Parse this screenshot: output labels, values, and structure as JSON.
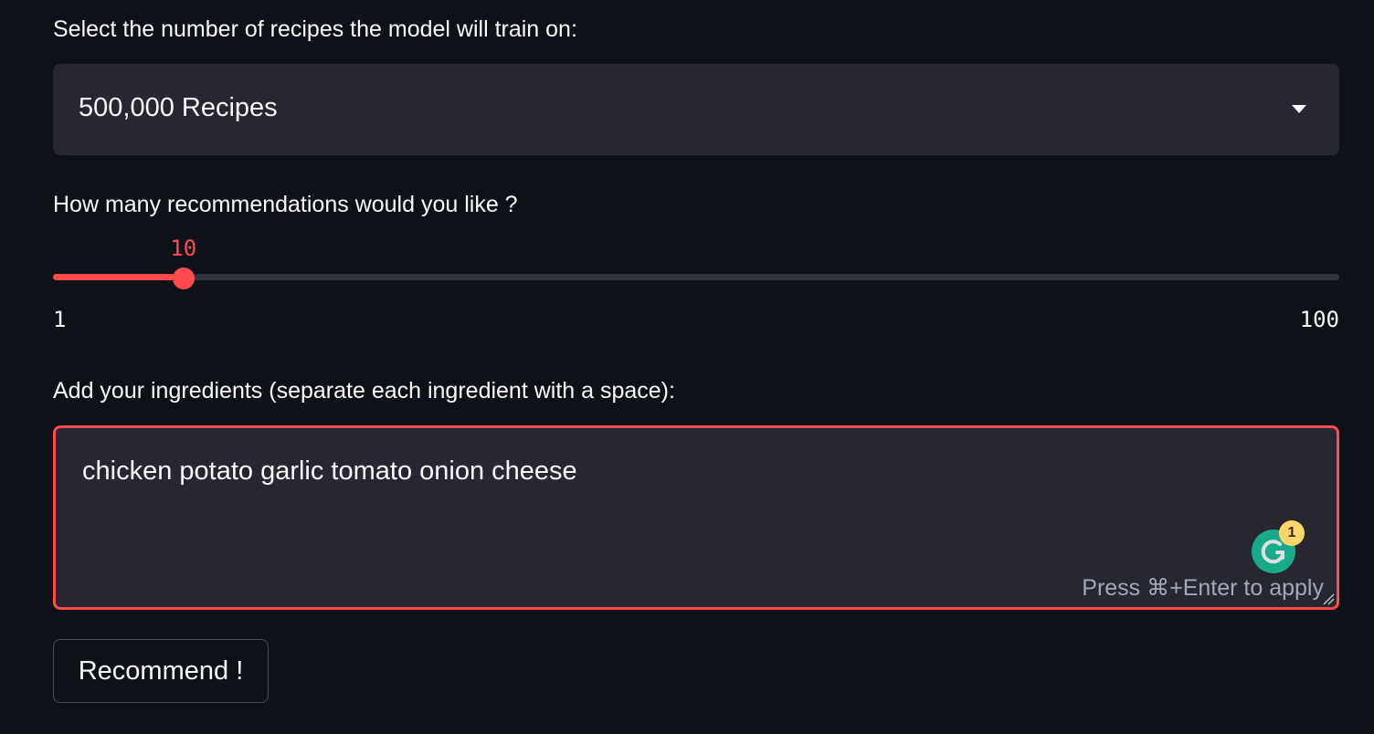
{
  "model_select": {
    "label": "Select the number of recipes the model will train on:",
    "selected": "500,000 Recipes",
    "caret_icon": "caret-down-icon"
  },
  "recommendations_slider": {
    "label": "How many recommendations would you like ?",
    "value": 10,
    "value_text": "10",
    "min": 1,
    "max": 100,
    "min_text": "1",
    "max_text": "100",
    "accent_color": "#ff4b4b"
  },
  "ingredients": {
    "label": "Add your ingredients (separate each ingredient with a space):",
    "value": "chicken potato garlic tomato onion cheese",
    "hint": "Press ⌘+Enter to apply"
  },
  "grammarly": {
    "icon": "grammarly-icon",
    "badge_count": "1",
    "color": "#15c39a"
  },
  "recommend_button": {
    "label": "Recommend !"
  },
  "theme": {
    "background": "#0e1117",
    "widget_bg": "#262730",
    "accent": "#ff4b4b"
  }
}
